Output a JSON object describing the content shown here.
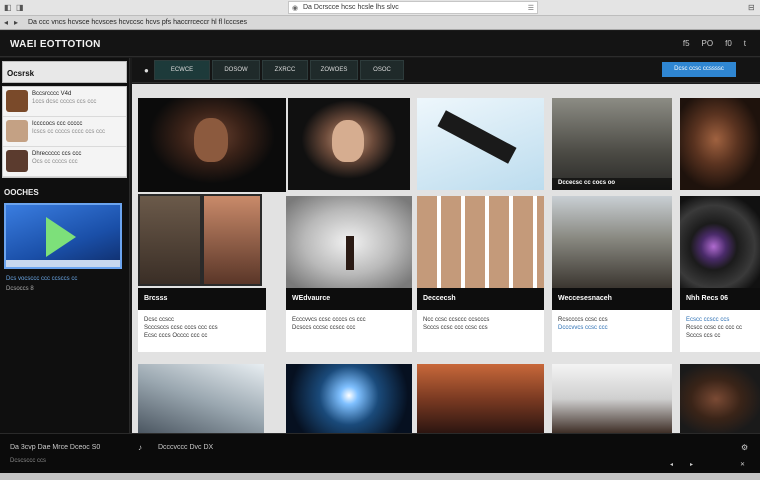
{
  "browser": {
    "tab_text": "Da  ccc  vncs  hcvsce  hcvsces  hcvccsc  hcvs  pfs  haccrrceccr  hl  fl  lcccses",
    "url": "Da  Dcrscce  hcsc  hcsle  lhs  slvc",
    "icons": [
      "back-icon",
      "forward-icon",
      "refresh-icon",
      "bookmark-icon"
    ]
  },
  "header": {
    "title": "WAEI EOTTOTION",
    "links": [
      "f5",
      "PO",
      "f0",
      "t"
    ]
  },
  "sidebar": {
    "title": "Ocsrsk",
    "feed": [
      {
        "title": "Bccsrcccc V4d",
        "meta": "1ccs  dcsc  ccccs  ccs  ccc",
        "color": "#7a4a2a"
      },
      {
        "title": "Iccccocs  ccc  ccccc",
        "meta": "Icscs  cc  ccccs  cccc  ccs  ccc",
        "color": "#c4a184"
      },
      {
        "title": "Dhreccccc  ccs  ccc",
        "meta": "Ocs  cc  ccccs  ccc",
        "color": "#5b3b2e"
      }
    ],
    "section_title": "OOCHES",
    "video_caption": "Dcs  vocsccc  ccc  ccsccs  cc",
    "video_caption2": "Dcsoccs  8"
  },
  "nav": {
    "tabs": [
      "ECWCE",
      "DOSOW",
      "ZXRCC",
      "ZOWOES",
      "OSOC"
    ],
    "button": "Dcsc  ccsc  ccssssc"
  },
  "cards": {
    "row2_titles": [
      "Brcsss",
      "WEdvaurce",
      "Deccecsh",
      "Weccesesnaceh",
      "Nhh  Recs  06"
    ],
    "row2_desc": [
      [
        "Dcsc  ccscc",
        "Scccsccs  ccsc  cccs  ccc  ccs",
        "Ecsc  cccs  Occcc  ccc  cc"
      ],
      [
        "Ecccvvcs  ccsc  ccccs  cs  ccc",
        "Dcsccs  cccsc  ccscc  ccc"
      ],
      [
        "Ncc  ccsc  ccsccc  ccscccs",
        "Scccs  ccsc  ccc  ccsc  ccs"
      ],
      [
        "Rcsccccs  ccsc  ccs",
        "Dcccvvcs  ccsc  ccc"
      ],
      [
        "Ecscc  ccscc  ccs",
        "Rcscc  ccsc  cc  ccc  cc",
        "Scccs  ccs  cc"
      ]
    ],
    "row1_overlay": "Dccecsc  cc  cocs  oo"
  },
  "bottom": {
    "left": "Da  3cvp  Dae  Mrce  Dceoc  S0",
    "left2": "Dcscsccc  ccs",
    "mid": "Dcccvccc  Dvc  DX"
  }
}
